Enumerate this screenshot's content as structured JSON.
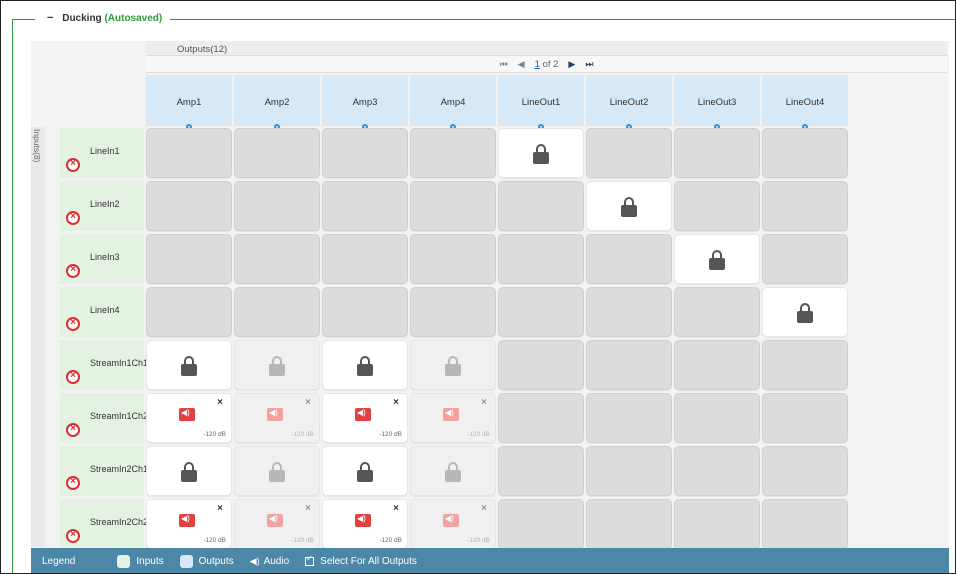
{
  "section": {
    "collapse_symbol": "−",
    "title": "Ducking",
    "status": "(Autosaved)"
  },
  "outputs": {
    "title": "Outputs(12)",
    "pager": {
      "first": "⏮",
      "prev": "◀",
      "page": "1",
      "of": "of 2",
      "next": "▶",
      "last": "⏭"
    },
    "columns": [
      "Amp1",
      "Amp2",
      "Amp3",
      "Amp4",
      "LineOut1",
      "LineOut2",
      "LineOut3",
      "LineOut4"
    ]
  },
  "inputs": {
    "title": "Inputs(8)",
    "rows": [
      "LineIn1",
      "LineIn2",
      "LineIn3",
      "LineIn4",
      "StreamIn1Ch1",
      "StreamIn1Ch2",
      "StreamIn2Ch1",
      "StreamIn2Ch2"
    ]
  },
  "grid": [
    [
      "empty",
      "empty",
      "empty",
      "empty",
      "lock",
      "empty",
      "empty",
      "empty"
    ],
    [
      "empty",
      "empty",
      "empty",
      "empty",
      "empty",
      "lock",
      "empty",
      "empty"
    ],
    [
      "empty",
      "empty",
      "empty",
      "empty",
      "empty",
      "empty",
      "lock",
      "empty"
    ],
    [
      "empty",
      "empty",
      "empty",
      "empty",
      "empty",
      "empty",
      "empty",
      "lock"
    ],
    [
      "lock",
      "lock-faint",
      "lock",
      "lock-faint",
      "empty",
      "empty",
      "empty",
      "empty"
    ],
    [
      "audio",
      "audio-faint",
      "audio",
      "audio-faint",
      "empty",
      "empty",
      "empty",
      "empty"
    ],
    [
      "lock",
      "lock-faint",
      "lock",
      "lock-faint",
      "empty",
      "empty",
      "empty",
      "empty"
    ],
    [
      "audio",
      "audio-faint",
      "audio",
      "audio-faint",
      "empty",
      "empty",
      "empty",
      "empty"
    ]
  ],
  "audio_cell": {
    "close": "×",
    "level": "-120 dB"
  },
  "legend": {
    "title": "Legend",
    "inputs": "Inputs",
    "outputs": "Outputs",
    "audio": "Audio",
    "select_all": "Select For All Outputs"
  },
  "colors": {
    "accent_green": "#2e9a3b",
    "input_header": "#e4f2e2",
    "output_header": "#d7e9f6",
    "legend_bar": "#4c87a8",
    "audio_red": "#e2413f",
    "remove_red": "#d93131"
  },
  "icons": {
    "lock": "lock-icon",
    "audio": "speaker-icon",
    "remove": "remove-circle-icon",
    "settings": "gear-icon",
    "check": "check-square-icon"
  }
}
